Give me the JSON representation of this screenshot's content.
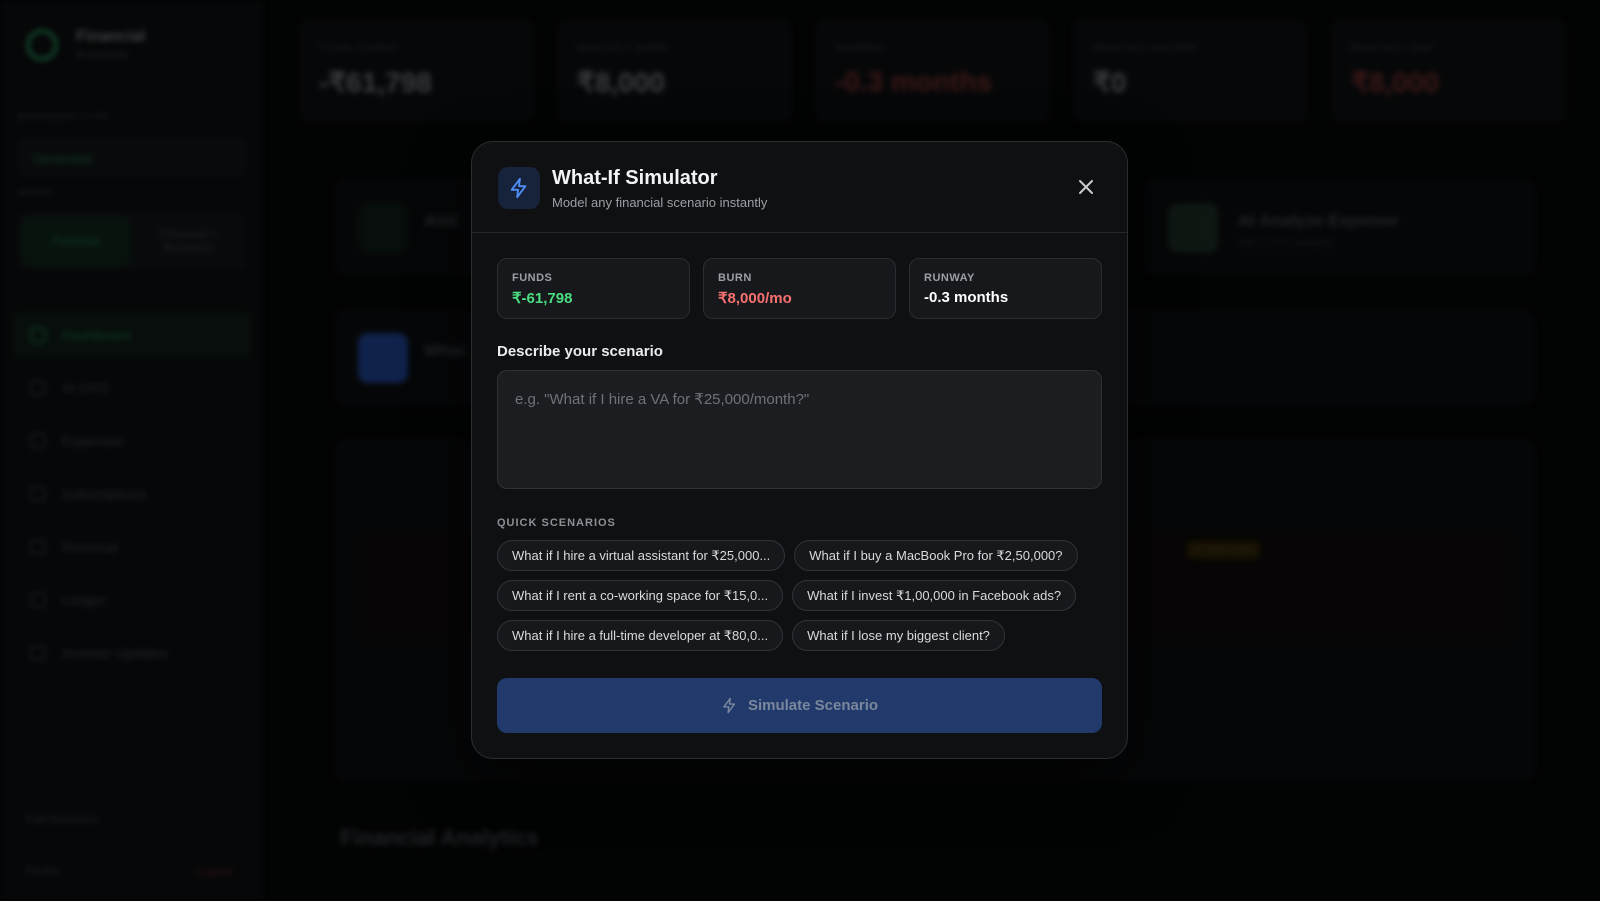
{
  "sidebar": {
    "brand_name": "Financial",
    "brand_sub": "AI Assistant",
    "section_business": "BUSINESS TYPE",
    "business_value": "Generalist",
    "section_mode": "MODE",
    "mode_options": [
      "Personal",
      "Personal + Business"
    ],
    "nav": [
      "Dashboard",
      "AI CFO",
      "Expenses",
      "Subscriptions",
      "Revenue",
      "Ledger",
      "Investor Updates"
    ],
    "footer_left": "Edit Business",
    "footer_profile": "Profile",
    "footer_logout": "Logout"
  },
  "stats": [
    {
      "label": "TOTAL FUNDS",
      "value": "-₹61,798"
    },
    {
      "label": "MONTHLY BURN",
      "value": "₹8,000"
    },
    {
      "label": "RUNWAY",
      "value": "-0.3 months"
    },
    {
      "label": "MONTHLY INCOME",
      "value": "₹0"
    },
    {
      "label": "MONTHLY GAP",
      "value": "₹8,000"
    }
  ],
  "background": {
    "card_add": "Add",
    "card_ai": "AI Analyze Expense",
    "card_ai_sub": "Get a CFO analysis",
    "card_what": "What",
    "section_title": "Financial Analytics",
    "alert_badge": "ATTENTION"
  },
  "modal": {
    "title": "What-If Simulator",
    "subtitle": "Model any financial scenario instantly",
    "metrics": [
      {
        "label": "FUNDS",
        "value": "₹-61,798",
        "color": "#4ade80"
      },
      {
        "label": "BURN",
        "value": "₹8,000/mo",
        "color": "#f87171"
      },
      {
        "label": "RUNWAY",
        "value": "-0.3 months",
        "color": "#ffffff"
      }
    ],
    "describe_label": "Describe your scenario",
    "input_value": "",
    "input_placeholder": "e.g. \"What if I hire a VA for ₹25,000/month?\"",
    "quick_label": "QUICK SCENARIOS",
    "quick_scenarios": [
      "What if I hire a virtual assistant for ₹25,000...",
      "What if I buy a MacBook Pro for ₹2,50,000?",
      "What if I rent a co-working space for ₹15,0...",
      "What if I invest ₹1,00,000 in Facebook ads?",
      "What if I hire a full-time developer at ₹80,0...",
      "What if I lose my biggest client?"
    ],
    "simulate_label": "Simulate Scenario"
  },
  "colors": {
    "accent_blue": "#213a6b",
    "icon_blue": "#3b82f6",
    "green": "#4ade80",
    "red": "#f87171"
  }
}
